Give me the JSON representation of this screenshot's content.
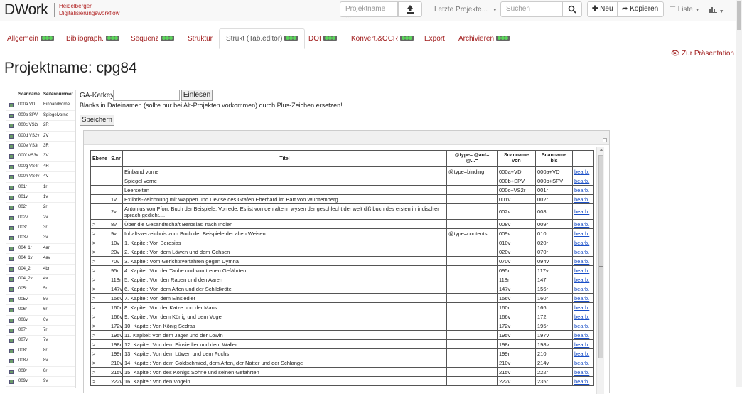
{
  "navbar": {
    "brand": "DWork",
    "brand_sub_line1": "Heidelberger",
    "brand_sub_line2": "Digitalisierungsworkflow",
    "project_placeholder": "Projektname ...",
    "recent_label": "Letzte Projekte...",
    "search_placeholder": "Suchen",
    "new_label": "Neu",
    "copy_label": "Kopieren",
    "list_label": "Liste"
  },
  "tabs": [
    {
      "label": "Allgemein",
      "lights": true
    },
    {
      "label": "Bibliograph.",
      "lights": true
    },
    {
      "label": "Sequenz",
      "lights": true
    },
    {
      "label": "Struktur",
      "lights": false
    },
    {
      "label": "Strukt (Tab.editor)",
      "lights": true
    },
    {
      "label": "DOI",
      "lights": true
    },
    {
      "label": "Konvert.&OCR",
      "lights": true
    },
    {
      "label": "Export",
      "lights": false
    },
    {
      "label": "Archivieren",
      "lights": true
    }
  ],
  "presentation_link": "Zur Präsentation",
  "page_title": "Projektname: cpg84",
  "leftlist": {
    "headers": [
      "Scanname",
      "Seitennummer"
    ],
    "rows": [
      [
        "000a VD",
        "Einbandvorne"
      ],
      [
        "000b SPV",
        "Spiegelvorne"
      ],
      [
        "000c VS2r",
        "2R"
      ],
      [
        "000d VS2v",
        "2V"
      ],
      [
        "000e VS3r",
        "3R"
      ],
      [
        "000f VS3v",
        "3V"
      ],
      [
        "000g VS4r",
        "4R"
      ],
      [
        "000h VS4v",
        "4V"
      ],
      [
        "001r",
        "1r"
      ],
      [
        "001v",
        "1v"
      ],
      [
        "002r",
        "2r"
      ],
      [
        "002v",
        "2v"
      ],
      [
        "003r",
        "3r"
      ],
      [
        "003v",
        "3v"
      ],
      [
        "004_1r",
        "4ar"
      ],
      [
        "004_1v",
        "4av"
      ],
      [
        "004_2r",
        "4br"
      ],
      [
        "004_2v",
        "4v"
      ],
      [
        "005r",
        "5r"
      ],
      [
        "005v",
        "5v"
      ],
      [
        "006r",
        "6r"
      ],
      [
        "006v",
        "6v"
      ],
      [
        "007r",
        "7r"
      ],
      [
        "007v",
        "7v"
      ],
      [
        "008r",
        "8r"
      ],
      [
        "008v",
        "8v"
      ],
      [
        "009r",
        "9r"
      ],
      [
        "009v",
        "9v"
      ]
    ]
  },
  "ga": {
    "label": "GA-Katkey:",
    "button": "Einlesen",
    "note": "Blanks in Dateinamen (sollte nur bei Alt-Projekten vorkommen) durch Plus-Zeichen ersetzen!",
    "save": "Speichern"
  },
  "table": {
    "headers": {
      "ebene": "Ebene",
      "snr": "S.nr",
      "titel": "Titel",
      "type": "@type= @aut= @...=",
      "von": "Scanname von",
      "bis": "Scanname bis",
      "action": ""
    },
    "rows": [
      {
        "ebene": "",
        "snr": "",
        "titel": "Einband vorne",
        "type": "@type=binding",
        "von": "000a+VD",
        "bis": "000a+VD",
        "action": "bearb."
      },
      {
        "ebene": "",
        "snr": "",
        "titel": "Spiegel vorne",
        "type": "",
        "von": "000b+SPV",
        "bis": "000b+SPV",
        "action": "bearb."
      },
      {
        "ebene": "",
        "snr": "",
        "titel": "Leerseiten",
        "type": "",
        "von": "000c+VS2r",
        "bis": "001r",
        "action": "bearb."
      },
      {
        "ebene": "",
        "snr": "1v",
        "titel": "Exlibris-Zeichnung mit Wappen und Devise des Grafen Eberhard im Bart von Württemberg",
        "type": "",
        "von": "001v",
        "bis": "002r",
        "action": "bearb."
      },
      {
        "ebene": "",
        "snr": "2v",
        "titel": "Antonius von Pforr, Buch der Beispiele, Vorrede: Es ist von den altenn wysen der geschlecht der welt diß buch des ersten in indischer sprach gedicht....",
        "type": "",
        "von": "002v",
        "bis": "008r",
        "action": "bearb.",
        "wrap": true
      },
      {
        "ebene": ">",
        "snr": "8v",
        "titel": "Über die Gesandtschaft Berosias' nach Indien",
        "type": "",
        "von": "008v",
        "bis": "009r",
        "action": "bearb."
      },
      {
        "ebene": ">",
        "snr": "9v",
        "titel": "Inhaltsverzeichnis zum Buch der Beispiele der alten Weisen",
        "type": "@type=contents",
        "von": "009v",
        "bis": "010r",
        "action": "bearb."
      },
      {
        "ebene": ">",
        "snr": "10v",
        "titel": "1. Kapitel: Von Berosias",
        "type": "",
        "von": "010v",
        "bis": "020r",
        "action": "bearb."
      },
      {
        "ebene": ">",
        "snr": "20v",
        "titel": "2. Kapitel: Von dem Löwen und dem Ochsen",
        "type": "",
        "von": "020v",
        "bis": "070r",
        "action": "bearb."
      },
      {
        "ebene": ">",
        "snr": "70v",
        "titel": "3. Kapitel: Vom Gerichtsverfahren gegen Dymna",
        "type": "",
        "von": "070v",
        "bis": "094v",
        "action": "bearb."
      },
      {
        "ebene": ">",
        "snr": "95r",
        "titel": "4. Kapitel: Von der Taube und von treuen Gefährten",
        "type": "",
        "von": "095r",
        "bis": "117v",
        "action": "bearb."
      },
      {
        "ebene": ">",
        "snr": "118r",
        "titel": "5. Kapitel: Von den Raben und den Aaren",
        "type": "",
        "von": "118r",
        "bis": "147r",
        "action": "bearb."
      },
      {
        "ebene": ">",
        "snr": "147v",
        "titel": "6. Kapitel: Von dem Affen und der Schildkröte",
        "type": "",
        "von": "147v",
        "bis": "156r",
        "action": "bearb."
      },
      {
        "ebene": ">",
        "snr": "156v",
        "titel": "7. Kapitel: Von dem Einsiedler",
        "type": "",
        "von": "156v",
        "bis": "160r",
        "action": "bearb."
      },
      {
        "ebene": ">",
        "snr": "160r",
        "titel": "8. Kapitel: Von der Katze und der Maus",
        "type": "",
        "von": "160r",
        "bis": "166r",
        "action": "bearb."
      },
      {
        "ebene": ">",
        "snr": "166v",
        "titel": "9. Kapitel: Von dem König und dem Vogel",
        "type": "",
        "von": "166v",
        "bis": "172r",
        "action": "bearb."
      },
      {
        "ebene": ">",
        "snr": "172v",
        "titel": "10. Kapitel: Von König Sedras",
        "type": "",
        "von": "172v",
        "bis": "195r",
        "action": "bearb."
      },
      {
        "ebene": ">",
        "snr": "195v",
        "titel": "11. Kapitel: Von dem Jäger und der Löwin",
        "type": "",
        "von": "195v",
        "bis": "197v",
        "action": "bearb."
      },
      {
        "ebene": ">",
        "snr": "198r",
        "titel": "12. Kapitel: Von dem Einsiedler und dem Waller",
        "type": "",
        "von": "198r",
        "bis": "198v",
        "action": "bearb."
      },
      {
        "ebene": ">",
        "snr": "199r",
        "titel": "13. Kapitel: Von dem Löwen und dem Fuchs",
        "type": "",
        "von": "199r",
        "bis": "210r",
        "action": "bearb."
      },
      {
        "ebene": ">",
        "snr": "210v",
        "titel": "14. Kapitel: Von dem Goldschmied, dem Affen, der Natter und der Schlange",
        "type": "",
        "von": "210v",
        "bis": "214v",
        "action": "bearb."
      },
      {
        "ebene": ">",
        "snr": "215v",
        "titel": "15. Kapitel: Von des Königs Sohne und seinen Gefährten",
        "type": "",
        "von": "215v",
        "bis": "222r",
        "action": "bearb."
      },
      {
        "ebene": ">",
        "snr": "222v",
        "titel": "16. Kapitel: Von den Vögeln",
        "type": "",
        "von": "222v",
        "bis": "235r",
        "action": "bearb."
      }
    ]
  }
}
